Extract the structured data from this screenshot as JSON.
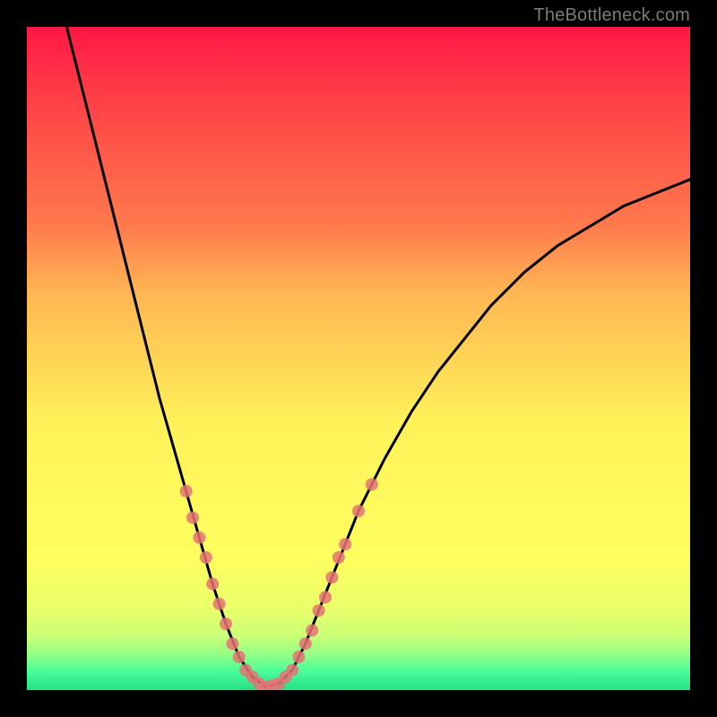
{
  "watermark": "TheBottleneck.com",
  "chart_data": {
    "type": "line",
    "title": "",
    "xlabel": "",
    "ylabel": "",
    "xlim": [
      0,
      100
    ],
    "ylim": [
      0,
      100
    ],
    "grid": false,
    "series": [
      {
        "name": "curve",
        "color": "#000000",
        "points": [
          {
            "x": 6,
            "y": 100
          },
          {
            "x": 8,
            "y": 92
          },
          {
            "x": 10,
            "y": 84
          },
          {
            "x": 12,
            "y": 76
          },
          {
            "x": 14,
            "y": 68
          },
          {
            "x": 16,
            "y": 60
          },
          {
            "x": 18,
            "y": 52
          },
          {
            "x": 20,
            "y": 44
          },
          {
            "x": 22,
            "y": 37
          },
          {
            "x": 24,
            "y": 30
          },
          {
            "x": 26,
            "y": 23
          },
          {
            "x": 28,
            "y": 16
          },
          {
            "x": 30,
            "y": 10
          },
          {
            "x": 32,
            "y": 5
          },
          {
            "x": 34,
            "y": 2
          },
          {
            "x": 36,
            "y": 0.5
          },
          {
            "x": 38,
            "y": 1
          },
          {
            "x": 40,
            "y": 3
          },
          {
            "x": 42,
            "y": 7
          },
          {
            "x": 44,
            "y": 12
          },
          {
            "x": 46,
            "y": 17
          },
          {
            "x": 48,
            "y": 22
          },
          {
            "x": 50,
            "y": 27
          },
          {
            "x": 54,
            "y": 35
          },
          {
            "x": 58,
            "y": 42
          },
          {
            "x": 62,
            "y": 48
          },
          {
            "x": 66,
            "y": 53
          },
          {
            "x": 70,
            "y": 58
          },
          {
            "x": 75,
            "y": 63
          },
          {
            "x": 80,
            "y": 67
          },
          {
            "x": 85,
            "y": 70
          },
          {
            "x": 90,
            "y": 73
          },
          {
            "x": 95,
            "y": 75
          },
          {
            "x": 100,
            "y": 77
          }
        ]
      },
      {
        "name": "highlight-dots",
        "color": "#e57373",
        "points": [
          {
            "x": 24,
            "y": 30
          },
          {
            "x": 25,
            "y": 26
          },
          {
            "x": 26,
            "y": 23
          },
          {
            "x": 27,
            "y": 20
          },
          {
            "x": 28,
            "y": 16
          },
          {
            "x": 29,
            "y": 13
          },
          {
            "x": 30,
            "y": 10
          },
          {
            "x": 31,
            "y": 7
          },
          {
            "x": 32,
            "y": 5
          },
          {
            "x": 33,
            "y": 3
          },
          {
            "x": 34,
            "y": 2
          },
          {
            "x": 35,
            "y": 1
          },
          {
            "x": 36,
            "y": 0.5
          },
          {
            "x": 37,
            "y": 0.7
          },
          {
            "x": 38,
            "y": 1
          },
          {
            "x": 39,
            "y": 2
          },
          {
            "x": 40,
            "y": 3
          },
          {
            "x": 41,
            "y": 5
          },
          {
            "x": 42,
            "y": 7
          },
          {
            "x": 43,
            "y": 9
          },
          {
            "x": 44,
            "y": 12
          },
          {
            "x": 45,
            "y": 14
          },
          {
            "x": 46,
            "y": 17
          },
          {
            "x": 47,
            "y": 20
          },
          {
            "x": 48,
            "y": 22
          },
          {
            "x": 50,
            "y": 27
          },
          {
            "x": 52,
            "y": 31
          }
        ]
      }
    ]
  }
}
